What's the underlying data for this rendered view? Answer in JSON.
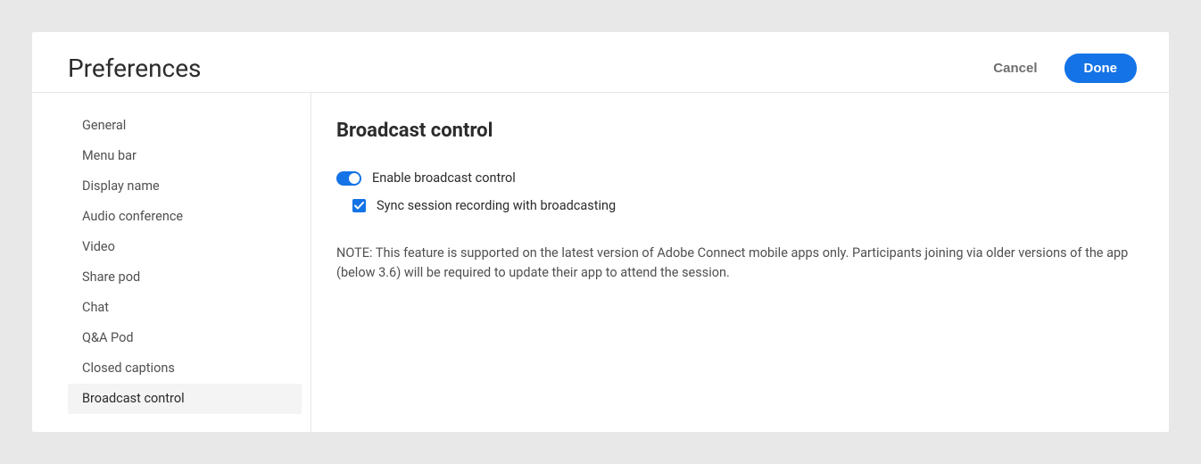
{
  "header": {
    "title": "Preferences",
    "cancel_label": "Cancel",
    "done_label": "Done"
  },
  "sidebar": {
    "items": [
      {
        "label": "General",
        "selected": false
      },
      {
        "label": "Menu bar",
        "selected": false
      },
      {
        "label": "Display name",
        "selected": false
      },
      {
        "label": "Audio conference",
        "selected": false
      },
      {
        "label": "Video",
        "selected": false
      },
      {
        "label": "Share pod",
        "selected": false
      },
      {
        "label": "Chat",
        "selected": false
      },
      {
        "label": "Q&A Pod",
        "selected": false
      },
      {
        "label": "Closed captions",
        "selected": false
      },
      {
        "label": "Broadcast control",
        "selected": true
      }
    ]
  },
  "main": {
    "section_title": "Broadcast control",
    "toggle": {
      "label": "Enable broadcast control",
      "on": true
    },
    "checkbox": {
      "label": "Sync session recording with broadcasting",
      "checked": true
    },
    "note": "NOTE: This feature is supported on the latest version of Adobe Connect mobile apps only. Participants joining via older versions of the app (below 3.6) will be required to update their app to attend the session."
  }
}
